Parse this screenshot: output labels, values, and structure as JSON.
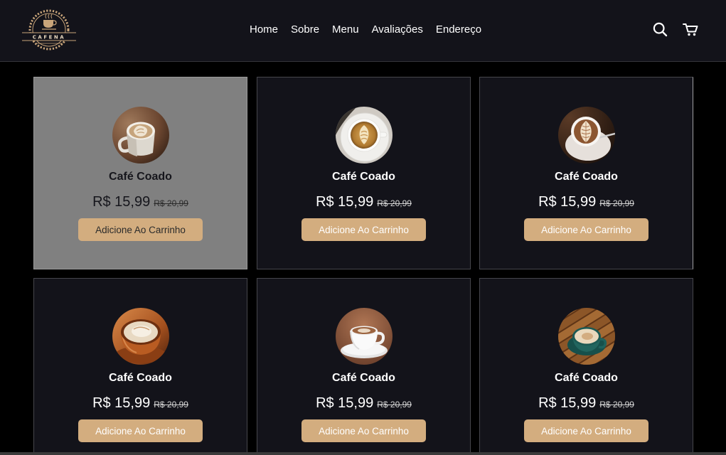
{
  "header": {
    "logo": {
      "text": "CAFENA",
      "icon": "coffee-cup-badge-logo-icon"
    },
    "nav": [
      {
        "label": "Home"
      },
      {
        "label": "Sobre"
      },
      {
        "label": "Menu"
      },
      {
        "label": "Avaliações"
      },
      {
        "label": "Endereço"
      }
    ],
    "icons": {
      "search": "search-icon",
      "cart": "cart-icon"
    }
  },
  "theme": {
    "accent": "#d3ad7f",
    "header_bg": "#13131a",
    "page_bg": "#000000",
    "card_bg": "#13131a",
    "card_hover_bg": "#808080"
  },
  "products": [
    {
      "photo_icon": "latte-mug-photo-icon",
      "name": "Café Coado",
      "price": "R$ 15,99",
      "old_price": "R$ 20,99",
      "button_label": "Adicione Ao Carrinho",
      "hovered": true
    },
    {
      "photo_icon": "latte-cup-top-view-photo-icon",
      "name": "Café Coado",
      "price": "R$ 15,99",
      "old_price": "R$ 20,99",
      "button_label": "Adicione Ao Carrinho",
      "hovered": false
    },
    {
      "photo_icon": "rosetta-latte-cup-photo-icon",
      "name": "Café Coado",
      "price": "R$ 15,99",
      "old_price": "R$ 20,99",
      "button_label": "Adicione Ao Carrinho",
      "hovered": false
    },
    {
      "photo_icon": "cappuccino-cup-photo-icon",
      "name": "Café Coado",
      "price": "R$ 15,99",
      "old_price": "R$ 20,99",
      "button_label": "Adicione Ao Carrinho",
      "hovered": false
    },
    {
      "photo_icon": "white-cup-on-saucer-photo-icon",
      "name": "Café Coado",
      "price": "R$ 15,99",
      "old_price": "R$ 20,99",
      "button_label": "Adicione Ao Carrinho",
      "hovered": false
    },
    {
      "photo_icon": "teal-cup-on-wooden-table-photo-icon",
      "name": "Café Coado",
      "price": "R$ 15,99",
      "old_price": "R$ 20,99",
      "button_label": "Adicione Ao Carrinho",
      "hovered": false
    }
  ]
}
